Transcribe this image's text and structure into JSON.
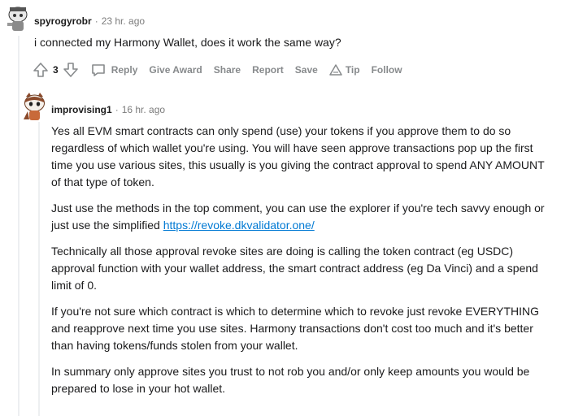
{
  "comment1": {
    "username": "spyrogyrobr",
    "time": "23 hr. ago",
    "body": "i connected my Harmony Wallet, does it work the same way?",
    "score": "3",
    "actions": {
      "reply": "Reply",
      "award": "Give Award",
      "share": "Share",
      "report": "Report",
      "save": "Save",
      "tip": "Tip",
      "follow": "Follow"
    }
  },
  "comment2": {
    "username": "improvising1",
    "time": "16 hr. ago",
    "paragraphs": [
      "Yes all EVM smart contracts can only spend (use) your tokens if you approve them to do so regardless of which wallet you're using. You will have seen approve transactions pop up the first time you use various sites, this usually is you giving the contract approval to spend ANY AMOUNT of that type of token.",
      "Technically all those approval revoke sites are doing is calling the token contract (eg USDC) approval function with your wallet address, the smart contract address (eg Da Vinci) and a spend limit of 0.",
      "If you're not sure which contract is which to determine which to revoke just revoke EVERYTHING and reapprove next time you use sites. Harmony transactions don't cost too much and it's better than having tokens/funds stolen from your wallet.",
      "In summary only approve sites you trust to not rob you and/or only keep amounts you would be prepared to lose in your hot wallet."
    ],
    "para2_prefix": "Just use the methods in the top comment, you can use the explorer if you're tech savvy enough or just use the simplified ",
    "para2_link": "https://revoke.dkvalidator.one/"
  },
  "colors": {
    "link": "#0079d3",
    "meta_gray": "#7c7c7c",
    "action_gray": "#878a8c"
  }
}
